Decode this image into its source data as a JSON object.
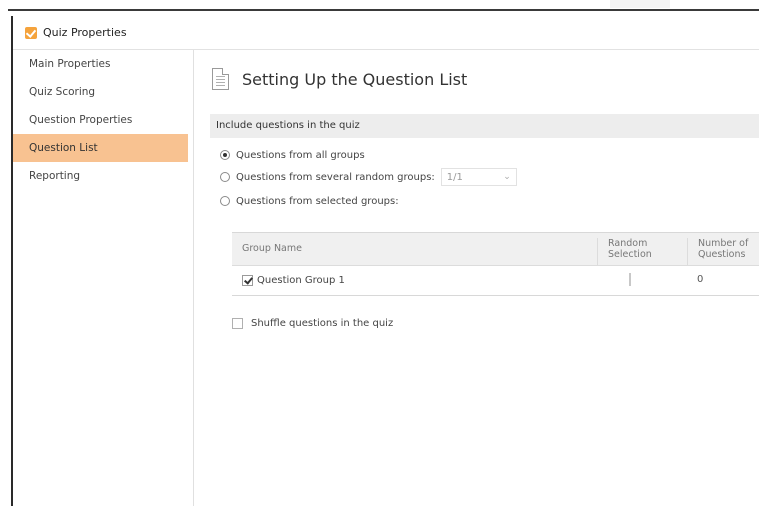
{
  "window": {
    "title": "Quiz Properties"
  },
  "sidebar": {
    "items": [
      {
        "label": "Main Properties",
        "active": false
      },
      {
        "label": "Quiz Scoring",
        "active": false
      },
      {
        "label": "Question Properties",
        "active": false
      },
      {
        "label": "Question List",
        "active": true
      },
      {
        "label": "Reporting",
        "active": false
      }
    ],
    "active_color": "#f8c291"
  },
  "main": {
    "title": "Setting Up the Question List",
    "section_header": "Include questions in the quiz",
    "options": {
      "all_groups": {
        "label": "Questions from all groups",
        "selected": true
      },
      "random_groups": {
        "label": "Questions from several random groups:",
        "selected": false,
        "select_value": "1/1"
      },
      "selected_groups": {
        "label": "Questions from selected groups:",
        "selected": false
      }
    },
    "table": {
      "headers": {
        "group_name": "Group Name",
        "random_line1": "Random",
        "random_line2": "Selection",
        "number_line1": "Number of",
        "number_line2": "Questions"
      },
      "rows": [
        {
          "name": "Question Group 1",
          "checked": true,
          "random_selection": false,
          "count": "0"
        }
      ]
    },
    "shuffle": {
      "label": "Shuffle questions in the quiz",
      "checked": false
    }
  },
  "icons": {
    "app": "quiz-check-icon",
    "page": "document-icon",
    "dropdown": "chevron-down-icon"
  }
}
